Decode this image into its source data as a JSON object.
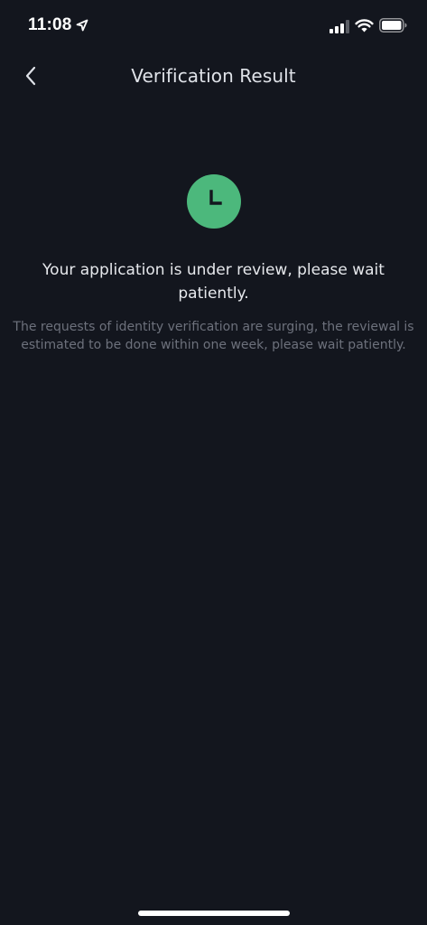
{
  "status_bar": {
    "time": "11:08"
  },
  "header": {
    "title": "Verification Result"
  },
  "result": {
    "icon": "clock-icon",
    "icon_color": "#4cb87c",
    "headline": "Your application is under review, please wait patiently.",
    "description": "The requests of identity verification are surging, the reviewal is estimated to be done within one week, please wait patiently."
  },
  "colors": {
    "background": "#13161e",
    "accent": "#4cb87c"
  }
}
